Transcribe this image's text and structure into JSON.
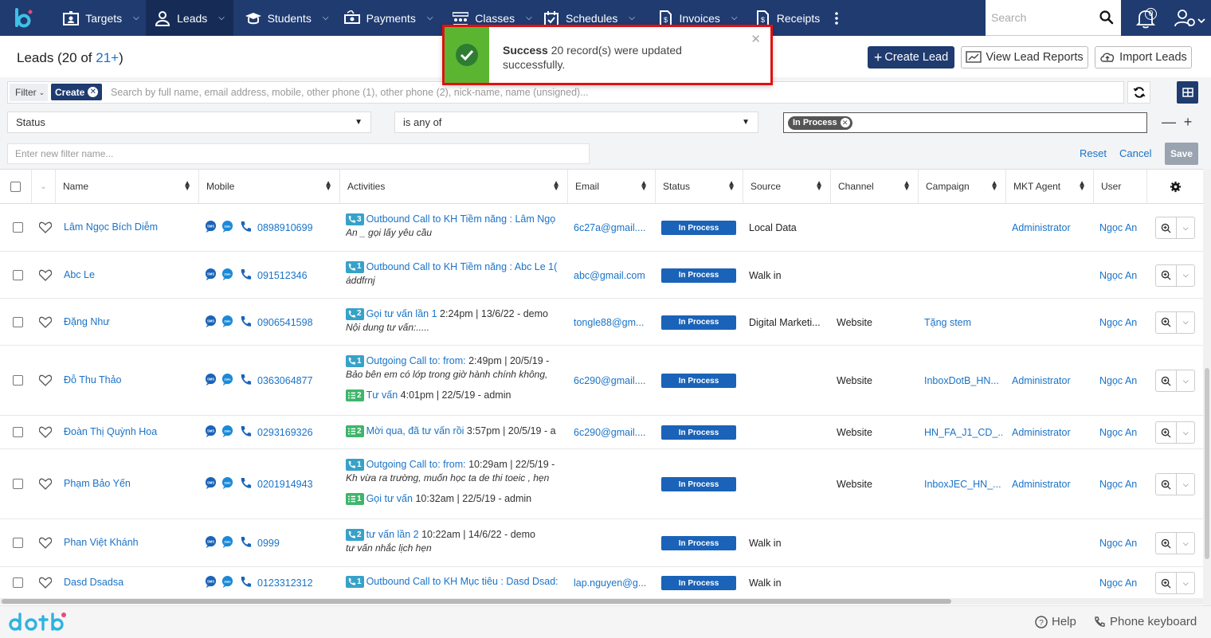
{
  "nav": {
    "items": [
      {
        "label": "Targets",
        "icon": "id-card-icon"
      },
      {
        "label": "Leads",
        "icon": "user-icon"
      },
      {
        "label": "Students",
        "icon": "graduation-cap-icon"
      },
      {
        "label": "Payments",
        "icon": "money-icon"
      },
      {
        "label": "Classes",
        "icon": "people-icon"
      },
      {
        "label": "Schedules",
        "icon": "calendar-icon"
      },
      {
        "label": "Invoices",
        "icon": "invoice-icon"
      },
      {
        "label": "Receipts",
        "icon": "receipt-icon"
      }
    ],
    "search_placeholder": "Search",
    "notification_count": "0"
  },
  "page": {
    "title_prefix": "Leads (20 of ",
    "title_count": "21+",
    "title_suffix": ")",
    "create_lead": "Create Lead",
    "view_reports": "View Lead Reports",
    "import_leads": "Import Leads"
  },
  "toast": {
    "title": "Success",
    "message": " 20 record(s) were updated successfully."
  },
  "filter": {
    "filter_label": "Filter",
    "create_tag": "Create",
    "search_placeholder": "Search by full name, email address, mobile, other phone (1), other phone (2), nick-name, name (unsigned)...",
    "field": "Status",
    "operator": "is any of",
    "value_tag": "In Process",
    "name_placeholder": "Enter new filter name...",
    "reset": "Reset",
    "cancel": "Cancel",
    "save": "Save"
  },
  "table": {
    "columns": [
      "Name",
      "Mobile",
      "Activities",
      "Email",
      "Status",
      "Source",
      "Channel",
      "Campaign",
      "MKT Agent",
      "User"
    ],
    "rows": [
      {
        "name": "Lâm Ngọc Bích Diễm",
        "mobile": "0898910699",
        "acts": [
          {
            "kind": "blue",
            "n": "3",
            "link": "Outbound Call to KH Tiềm năng : Lâm Ngọ",
            "rest": ""
          }
        ],
        "note": "An _ gọi lấy yêu cầu",
        "email": "6c27a@gmail....",
        "status": "In Process",
        "source": "Local Data",
        "channel": "",
        "campaign": "",
        "agent": "Administrator",
        "user": "Ngọc An"
      },
      {
        "name": "Abc Le",
        "mobile": "091512346",
        "acts": [
          {
            "kind": "blue",
            "n": "1",
            "link": "Outbound Call to KH Tiềm năng : Abc Le 1(",
            "rest": ""
          }
        ],
        "note": "áddfrnj",
        "email": "abc@gmail.com",
        "status": "In Process",
        "source": "Walk in",
        "channel": "",
        "campaign": "",
        "agent": "",
        "user": "Ngọc An"
      },
      {
        "name": "Đặng Như",
        "mobile": "0906541598",
        "acts": [
          {
            "kind": "blue",
            "n": "2",
            "link": "Gọi tư vấn lần 1",
            "rest": " 2:24pm | 13/6/22 - demo"
          }
        ],
        "note": "Nội dung tư vấn:.....",
        "email": "tongle88@gm...",
        "status": "In Process",
        "source": "Digital Marketi...",
        "channel": "Website",
        "campaign": "Tặng stem",
        "agent": "",
        "user": "Ngọc An"
      },
      {
        "name": "Đỗ Thu Thảo",
        "mobile": "0363064877",
        "acts": [
          {
            "kind": "blue",
            "n": "1",
            "link": "Outgoing Call to: from:",
            "rest": " 2:49pm | 20/5/19 -"
          }
        ],
        "note": "Bảo bên em có lớp trong giờ hành chính không,",
        "acts2": [
          {
            "kind": "green",
            "n": "2",
            "link": "Tư vấn",
            "rest": " 4:01pm | 22/5/19 - admin"
          }
        ],
        "email": "6c290@gmail....",
        "status": "In Process",
        "source": "",
        "channel": "Website",
        "campaign": "InboxDotB_HN...",
        "agent": "Administrator",
        "user": "Ngọc An"
      },
      {
        "name": "Đoàn Thị Quỳnh Hoa",
        "mobile": "0293169326",
        "acts": [
          {
            "kind": "green",
            "n": "2",
            "link": "Mời qua, đã tư vấn rồi",
            "rest": " 3:57pm | 20/5/19 - a"
          }
        ],
        "note": "",
        "email": "6c290@gmail....",
        "status": "In Process",
        "source": "",
        "channel": "Website",
        "campaign": "HN_FA_J1_CD_...",
        "agent": "Administrator",
        "user": "Ngọc An"
      },
      {
        "name": "Phạm Bảo Yến",
        "mobile": "0201914943",
        "acts": [
          {
            "kind": "blue",
            "n": "1",
            "link": "Outgoing Call to: from:",
            "rest": " 10:29am | 22/5/19 -"
          }
        ],
        "note": "Kh vừa ra trường, muốn học ta de thi toeic , hẹn",
        "acts2": [
          {
            "kind": "green",
            "n": "1",
            "link": "Gọi tư vấn",
            "rest": " 10:32am | 22/5/19 - admin"
          }
        ],
        "email": "",
        "status": "In Process",
        "source": "",
        "channel": "Website",
        "campaign": "InboxJEC_HN_...",
        "agent": "Administrator",
        "user": "Ngọc An"
      },
      {
        "name": "Phan Việt Khánh",
        "mobile": "0999",
        "acts": [
          {
            "kind": "blue",
            "n": "2",
            "link": "tư vấn lần 2",
            "rest": " 10:22am | 14/6/22 - demo"
          }
        ],
        "note": "tư vấn nhắc lịch hẹn",
        "email": "",
        "status": "In Process",
        "source": "Walk in",
        "channel": "",
        "campaign": "",
        "agent": "",
        "user": "Ngọc An"
      },
      {
        "name": "Dasd Dsadsa",
        "mobile": "0123312312",
        "acts": [
          {
            "kind": "blue",
            "n": "1",
            "link": "Outbound Call to KH Mục tiêu : Dasd Dsad:",
            "rest": ""
          }
        ],
        "note": "",
        "email": "lap.nguyen@g...",
        "status": "In Process",
        "source": "Walk in",
        "channel": "",
        "campaign": "",
        "agent": "",
        "user": "Ngọc An"
      }
    ]
  },
  "footer": {
    "brand": "dotb",
    "help": "Help",
    "phone_keyboard": "Phone keyboard"
  }
}
